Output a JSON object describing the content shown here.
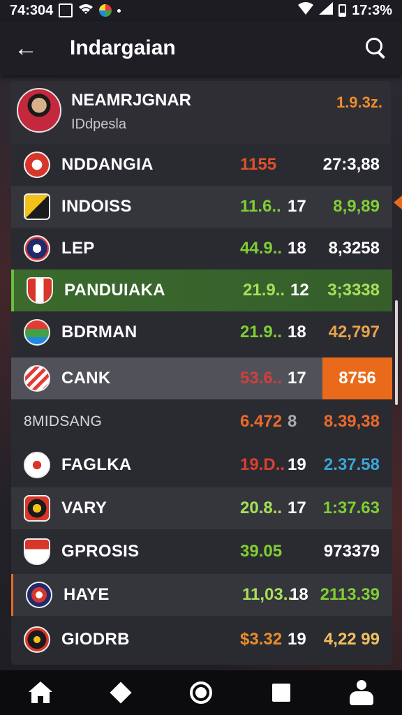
{
  "status_bar": {
    "time": "74:304",
    "battery": "17:3%"
  },
  "app_bar": {
    "title": "Indargaian"
  },
  "profile": {
    "name": "NEAMRJGNAR",
    "subtitle": "IDdpesla",
    "value": "1.9.3z."
  },
  "rows": [
    {
      "team": "NDDANGIA",
      "v1": "1155",
      "v2": "",
      "v3": "27:3,88",
      "v1_color": "#e0502c",
      "v3_color": "#ffffff"
    },
    {
      "team": "INDOISS",
      "v1": "11.6..",
      "v2": "17",
      "v3": "8,9,89",
      "v1_color": "#7fcf33",
      "v3_color": "#7fcf33"
    },
    {
      "team": "LEP",
      "v1": "44.9..",
      "v2": "18",
      "v3": "8,3258",
      "v1_color": "#7fcf33",
      "v3_color": "#ffffff"
    },
    {
      "team": "PANDUIAKA",
      "v1": "21.9..",
      "v2": "12",
      "v3": "3;3338",
      "v1_color": "#a6e05a",
      "v3_color": "#a6e05a"
    },
    {
      "team": "BDRMAN",
      "v1": "21.9..",
      "v2": "18",
      "v3": "42,797",
      "v1_color": "#7fcf33",
      "v3_color": "#e8a24a"
    },
    {
      "team": "CANK",
      "v1": "53.6..",
      "v2": "17",
      "v3": "8756",
      "v1_color": "#d0403a",
      "v3_color": "#ffffff"
    },
    {
      "team": "8MIDSANG",
      "v1": "6.472",
      "v2": "8",
      "v3": "8.39,38",
      "v1_color": "#ea6a2a",
      "v3_color": "#ea6a2a"
    },
    {
      "team": "FAGLKA",
      "v1": "19.D..",
      "v2": "19",
      "v3": "2.37.58",
      "v1_color": "#d84030",
      "v3_color": "#3aa6d8"
    },
    {
      "team": "VARY",
      "v1": "20.8..",
      "v2": "17",
      "v3": "1:37.63",
      "v1_color": "#a6e05a",
      "v3_color": "#7fcf33"
    },
    {
      "team": "GPROSIS",
      "v1": "39.05",
      "v2": "",
      "v3": "973379",
      "v1_color": "#7fcf33",
      "v3_color": "#ffffff"
    },
    {
      "team": "HAYE",
      "v1": "11,03..",
      "v2": "18",
      "v3": "2113.39",
      "v1_color": "#a6e05a",
      "v3_color": "#7fcf33"
    },
    {
      "team": "GIODRB",
      "v1": "$3.32",
      "v2": "19",
      "v3": "4,22 99",
      "v1_color": "#ea8c2a",
      "v3_color": "#f0c060"
    }
  ],
  "icons": {
    "back": "arrow-left-icon",
    "search": "search-icon",
    "nav": [
      "home-icon",
      "diamond-icon",
      "circle-icon",
      "square-icon",
      "user-icon"
    ]
  },
  "colors": {
    "accent": "#ea6a1c",
    "positive": "#7fcf33",
    "negative": "#d0403a"
  }
}
